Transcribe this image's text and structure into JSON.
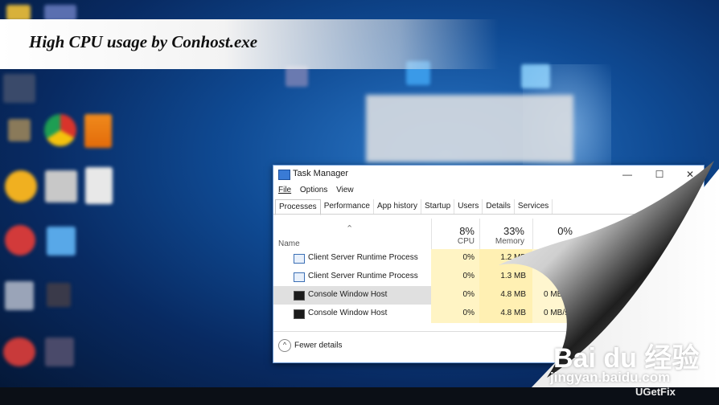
{
  "banner": {
    "title": "High CPU usage by Conhost.exe"
  },
  "window": {
    "title": "Task Manager",
    "minimize_glyph": "—",
    "maximize_glyph": "☐",
    "close_glyph": "✕"
  },
  "menu": [
    "File",
    "Options",
    "View"
  ],
  "tabs": [
    "Processes",
    "Performance",
    "App history",
    "Startup",
    "Users",
    "Details",
    "Services"
  ],
  "columns": {
    "name": "Name",
    "cpu": {
      "pct": "8%",
      "label": "CPU"
    },
    "memory": {
      "pct": "33%",
      "label": "Memory"
    },
    "disk": {
      "pct": "0%",
      "label": ""
    }
  },
  "rows": [
    {
      "name": "Client Server Runtime Process",
      "cpu": "0%",
      "memory": "1.2 MB",
      "disk": "",
      "icon": "window-icon"
    },
    {
      "name": "Client Server Runtime Process",
      "cpu": "0%",
      "memory": "1.3 MB",
      "disk": "",
      "icon": "window-icon"
    },
    {
      "name": "Console Window Host",
      "cpu": "0%",
      "memory": "4.8 MB",
      "disk": "0 MB/s",
      "icon": "console-icon"
    },
    {
      "name": "Console Window Host",
      "cpu": "0%",
      "memory": "4.8 MB",
      "disk": "0 MB/s",
      "icon": "console-icon"
    }
  ],
  "footer": {
    "fewer_details": "Fewer details",
    "chevron": "^"
  },
  "watermark": {
    "baidu": "Bai du 经验",
    "url": "jingyan.baidu.com",
    "ugetfix": "UGetFix"
  }
}
